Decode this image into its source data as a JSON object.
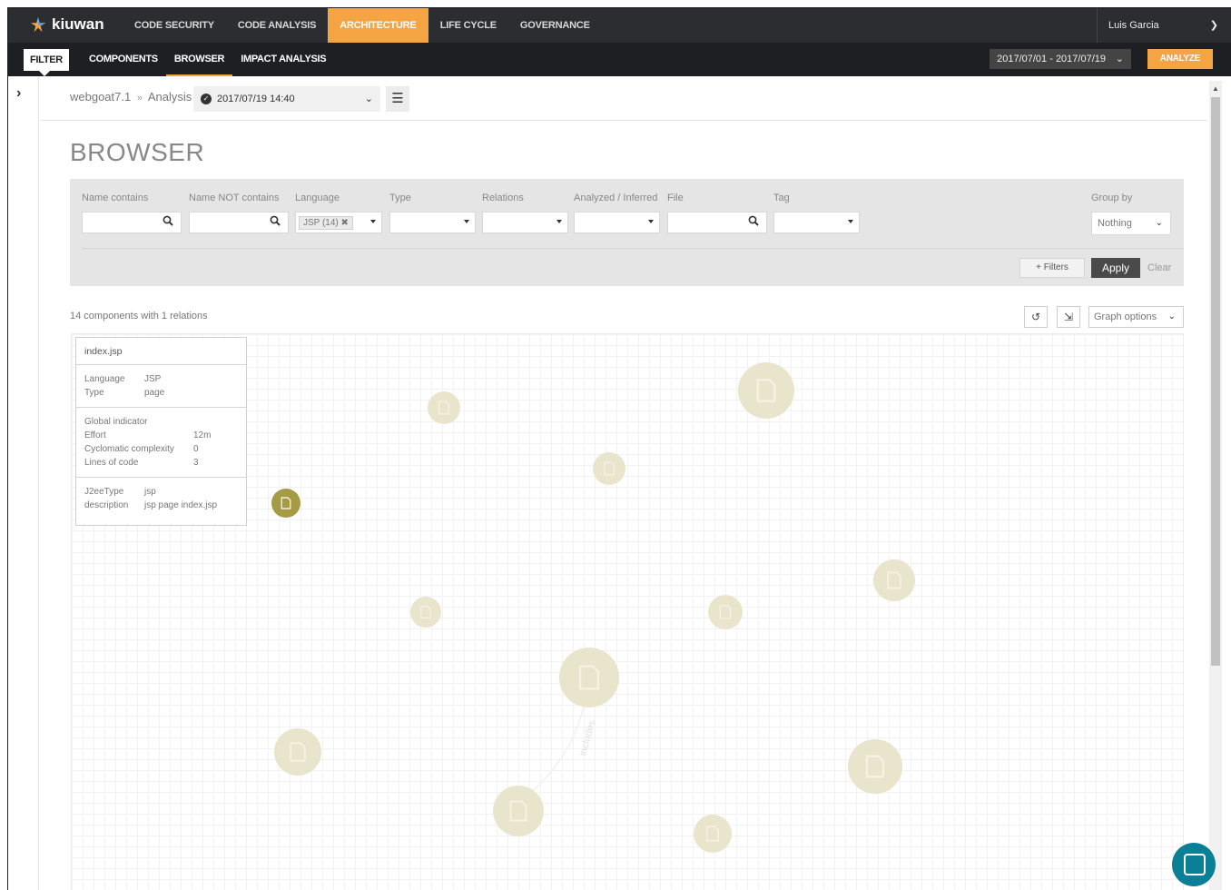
{
  "app": {
    "logo_text": "kiuwan",
    "nav": [
      {
        "label": "CODE SECURITY",
        "active": false
      },
      {
        "label": "CODE ANALYSIS",
        "active": false
      },
      {
        "label": "ARCHITECTURE",
        "active": true
      },
      {
        "label": "LIFE CYCLE",
        "active": false
      },
      {
        "label": "GOVERNANCE",
        "active": false
      }
    ],
    "user_name": "Luis Garcia"
  },
  "subbar": {
    "filter_label": "FILTER",
    "tabs": [
      {
        "label": "COMPONENTS",
        "active": false
      },
      {
        "label": "BROWSER",
        "active": true
      },
      {
        "label": "IMPACT ANALYSIS",
        "active": false
      }
    ],
    "date_range": "2017/07/01 - 2017/07/19",
    "analyze_label": "ANALYZE"
  },
  "breadcrumb": {
    "app": "webgoat7.1",
    "separator": "»",
    "section": "Analysis",
    "analysis_date": "2017/07/19 14:40"
  },
  "page_title": "BROWSER",
  "filters": {
    "name_contains": {
      "label": "Name contains",
      "value": ""
    },
    "name_not_contains": {
      "label": "Name NOT contains",
      "value": ""
    },
    "language": {
      "label": "Language",
      "chip": "JSP (14)"
    },
    "type": {
      "label": "Type",
      "value": ""
    },
    "relations": {
      "label": "Relations",
      "value": ""
    },
    "analyzed_inferred": {
      "label": "Analyzed / Inferred",
      "value": ""
    },
    "file": {
      "label": "File",
      "value": ""
    },
    "tag": {
      "label": "Tag",
      "value": ""
    },
    "group_by": {
      "label": "Group by",
      "value": "Nothing"
    },
    "more_filters": "+ Filters",
    "apply": "Apply",
    "clear": "Clear"
  },
  "summary_text": "14 components with 1 relations",
  "graph_options_label": "Graph options",
  "detail_card": {
    "title": "index.jsp",
    "language_key": "Language",
    "language_value": "JSP",
    "type_key": "Type",
    "type_value": "page",
    "global_indicator": "Global indicator",
    "effort_key": "Effort",
    "effort_value": "12m",
    "cyclomatic_key": "Cyclomatic complexity",
    "cyclomatic_value": "0",
    "loc_key": "Lines of code",
    "loc_value": "3",
    "j2ee_key": "J2eeType",
    "j2ee_value": "jsp",
    "description_key": "description",
    "description_value": "jsp page index.jsp"
  },
  "graph": {
    "edge_label": "includes",
    "node_color": "#e9e4cc",
    "selected_color": "#a69b45"
  }
}
